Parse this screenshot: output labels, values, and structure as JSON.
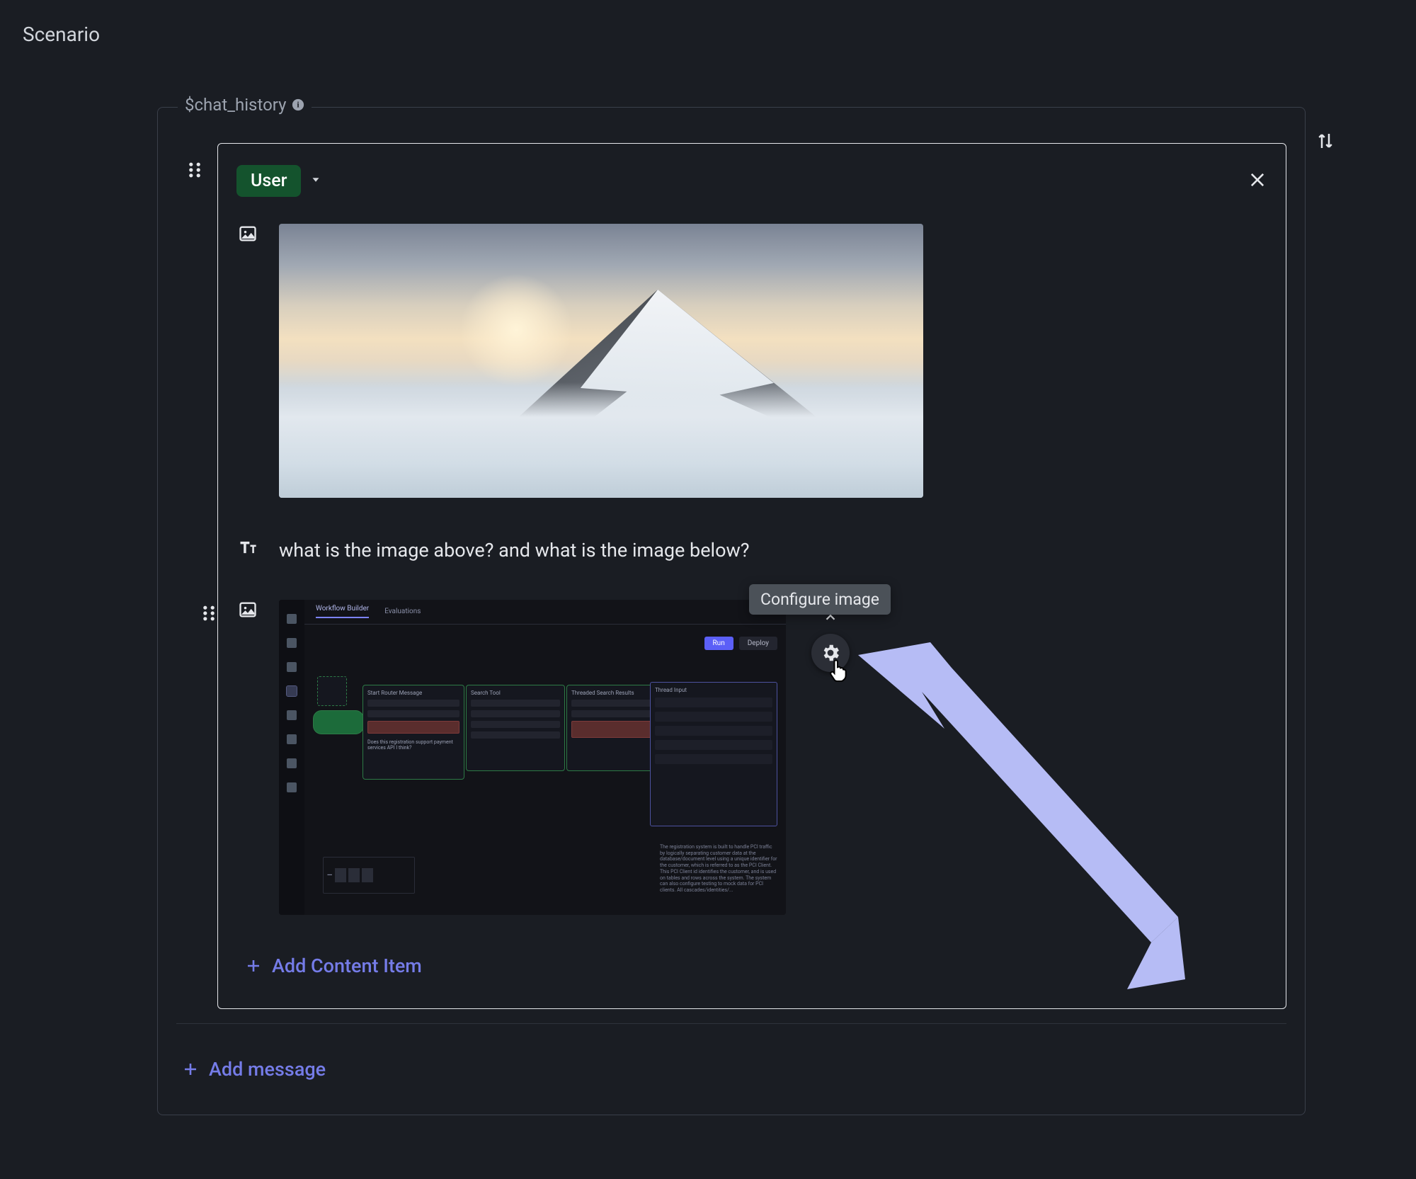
{
  "page": {
    "title": "Scenario"
  },
  "fieldset": {
    "legend": "$chat_history"
  },
  "message": {
    "role_label": "User",
    "content": {
      "image1_alt": "Snow-capped mountain peak rising above a sea of clouds at golden hour",
      "text": "what is the image above? and what is the image below?",
      "image2_alt": "Screenshot of a dark workflow-builder UI with connected nodes and a side panel",
      "workflow_tabs": {
        "builder": "Workflow Builder",
        "evals": "Evaluations"
      },
      "workflow_buttons": {
        "run": "Run",
        "deploy": "Deploy"
      },
      "workflow_panel_title": "Thread Input",
      "workflow_output_blurb": "The registration system is built to handle PCI traffic by logically separating customer data at the database/document level using a unique identifier for the customer, which is referred to as the PCI Client. This PCI Client id identifies the customer, and is used on tables and rows across the system. The system can also configure testing to mock data for PCI clients. All cascades/identities/..."
    }
  },
  "tooltip": {
    "configure_image": "Configure image"
  },
  "actions": {
    "add_content_item": "Add Content Item",
    "add_message": "Add message"
  }
}
